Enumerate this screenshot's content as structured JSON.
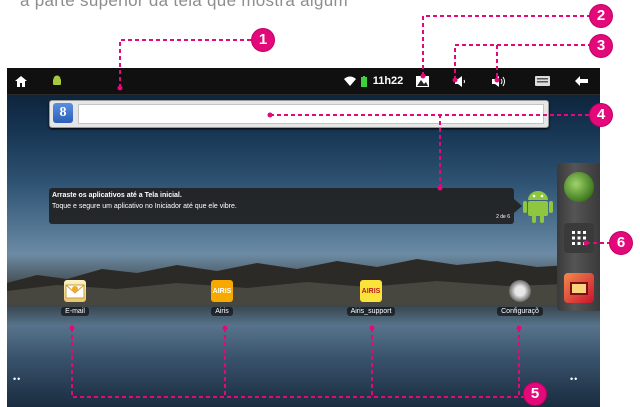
{
  "caption": "a parte superior da tela que mostra algum",
  "status_bar": {
    "icons": [
      "home-icon",
      "android-debug-icon",
      "wifi-icon",
      "battery-icon",
      "gallery-icon",
      "volume-down-icon",
      "volume-up-icon",
      "keyboard-icon",
      "back-icon"
    ],
    "time": "11h22"
  },
  "search": {
    "g_label": "8",
    "placeholder": ""
  },
  "tip": {
    "title": "Arraste os aplicativos até a Tela inicial.",
    "body": "Toque e segure um aplicativo no Iniciador até que ele vibre.",
    "page": "2 de 6"
  },
  "shortcuts": [
    {
      "label": "E-mail",
      "icon": "email-icon"
    },
    {
      "label": "Airis",
      "icon": "airis-icon",
      "icon_text": "AIRIS"
    },
    {
      "label": "Airis_support",
      "icon": "airis-support-icon",
      "icon_text": "AIRIS"
    },
    {
      "label": "Configuraçõ",
      "icon": "settings-icon"
    }
  ],
  "pager_dots": [
    "••",
    "••"
  ],
  "callouts": [
    "1",
    "2",
    "3",
    "4",
    "5",
    "6"
  ],
  "colors": {
    "accent": "#e4097a",
    "statusbar": "#101010"
  }
}
